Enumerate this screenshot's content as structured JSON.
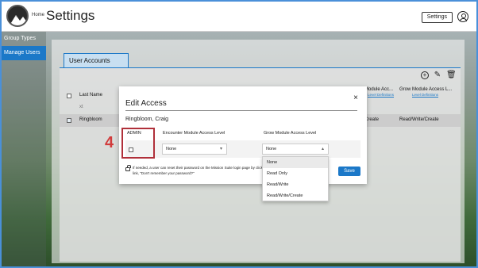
{
  "header": {
    "home_label": "Home",
    "title": "Settings",
    "settings_button": "Settings",
    "user_icon": "user-circle-icon"
  },
  "sidebar": {
    "items": [
      {
        "label": "Group Types",
        "active": false
      },
      {
        "label": "Manage Users",
        "active": true
      }
    ]
  },
  "main": {
    "tab_label": "User Accounts",
    "toolbar_icons": [
      "add-icon",
      "edit-icon",
      "delete-icon"
    ],
    "table": {
      "columns": [
        {
          "label": "Last Name",
          "link": ""
        },
        {
          "label": "Module Acc...",
          "link": "Level Definitions"
        },
        {
          "label": "Grow Module Access L...",
          "link": "Level Definitions"
        }
      ],
      "filter_placeholder": "xt",
      "selected_row": {
        "last_name": "Ringbloom",
        "module_access": "Create",
        "grow_access": "Read/Write/Create"
      }
    }
  },
  "modal": {
    "title": "Edit Access",
    "user": "Ringbloom, Craig",
    "columns": {
      "admin": "ADMIN",
      "encounter": "Encounter Module Access Level",
      "grow": "Grow Module Access Level"
    },
    "admin_checked": false,
    "encounter_value": "None",
    "grow_value": "None",
    "hint": "If needed, a user can reset their password on the Mission Suite login page by clicking the link, \"Don't remember your password?\"",
    "save_label": "Save",
    "close_label": "×"
  },
  "dropdown": {
    "options": [
      "None",
      "Read Only",
      "Read/Write",
      "Read/Write/Create"
    ],
    "selected": "None"
  },
  "annotation": {
    "step_number": "4"
  },
  "colors": {
    "accent": "#1b78c8",
    "annotation": "#d13b3b"
  }
}
